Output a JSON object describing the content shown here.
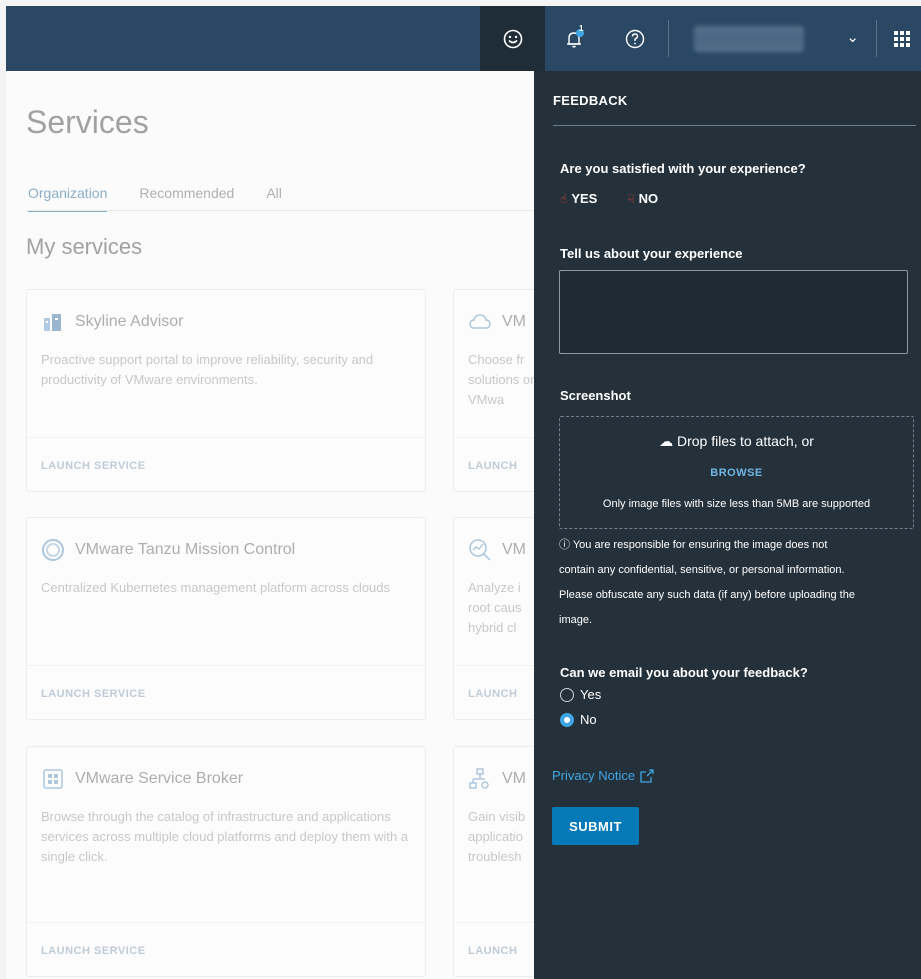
{
  "topbar": {
    "feedback_icon": "smiley-icon",
    "notification_count": "1",
    "help_icon": "help-icon",
    "apps_icon": "apps-grid-icon"
  },
  "page": {
    "title": "Services",
    "tabs": [
      "Organization",
      "Recommended",
      "All"
    ],
    "section_title": "My services",
    "cards": [
      {
        "title": "Skyline Advisor",
        "desc": "Proactive support portal to improve reliability, security and productivity of VMware environments.",
        "launch": "LAUNCH SERVICE"
      },
      {
        "title": "VM",
        "desc": "Choose fr solutions on VMwa",
        "launch": "LAUNCH"
      },
      {
        "title": "VMware Tanzu Mission Control",
        "desc": "Centralized Kubernetes management platform across clouds",
        "launch": "LAUNCH SERVICE"
      },
      {
        "title": "VM",
        "desc": "Analyze i root caus hybrid cl",
        "launch": "LAUNCH"
      },
      {
        "title": "VMware Service Broker",
        "desc": "Browse through the catalog of infrastructure and applications services across multiple cloud platforms and deploy them with a single click.",
        "launch": "LAUNCH SERVICE"
      },
      {
        "title": "VM",
        "desc": "Gain visib applicatio troublesh",
        "launch": "LAUNCH"
      }
    ]
  },
  "feedback": {
    "heading": "FEEDBACK",
    "q_satisfied": "Are you satisfied with your experience?",
    "yes_label": "YES",
    "no_label": "NO",
    "q_tell": "Tell us about your experience",
    "textarea_value": "",
    "screenshot_label": "Screenshot",
    "drop_text": "Drop files to attach, or",
    "browse_label": "BROWSE",
    "drop_hint": "Only image files with size less than 5MB are supported",
    "note_line1": "You are responsible for ensuring the image does not",
    "note_line2": "contain any confidential, sensitive, or personal information.",
    "note_line3": "Please obfuscate any such data (if any) before uploading the",
    "note_line4": "image.",
    "q_email": "Can we email you about your feedback?",
    "email_yes": "Yes",
    "email_no": "No",
    "email_selected": "No",
    "privacy_label": "Privacy Notice",
    "submit_label": "SUBMIT"
  },
  "colors": {
    "topbar": "#2a4864",
    "panel": "#24313b",
    "accent": "#0479b7",
    "link": "#3fa6e3",
    "thumb": "#e6402b"
  }
}
